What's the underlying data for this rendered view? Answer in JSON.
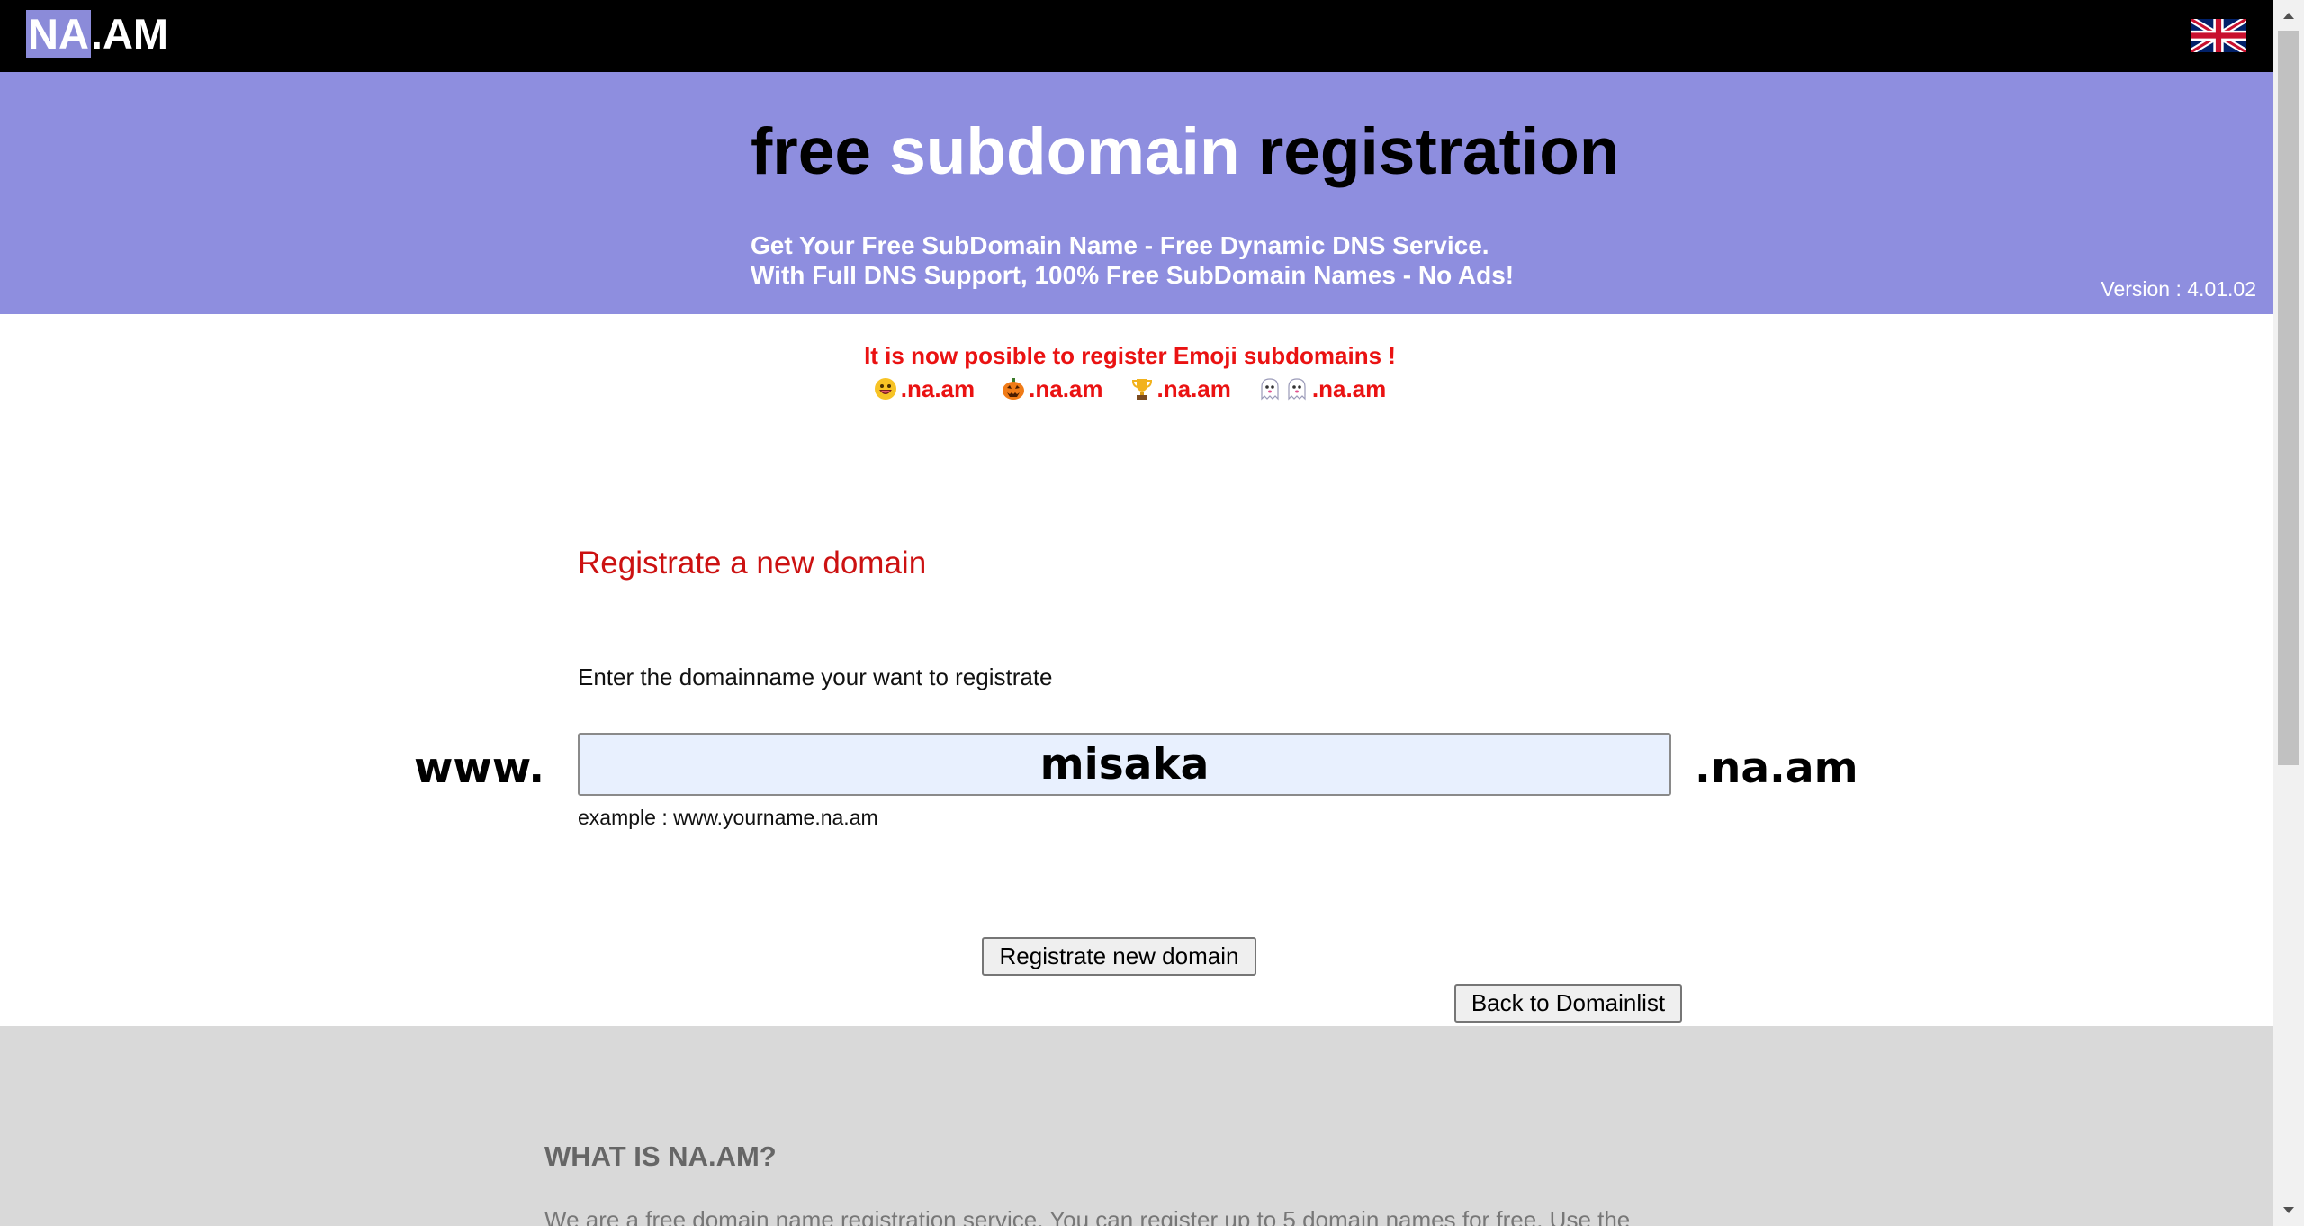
{
  "topbar": {
    "logo_highlight": "NA",
    "logo_rest": ".AM",
    "flag_icon": "uk-flag-icon"
  },
  "hero": {
    "title_part1": "free ",
    "title_part2": "subdomain",
    "title_part3": " registration",
    "subtitle_line1": "Get Your Free SubDomain Name - Free Dynamic DNS Service.",
    "subtitle_line2": "With Full DNS Support, 100% Free SubDomain Names - No Ads!",
    "version": "Version : 4.01.02"
  },
  "notice": {
    "title": "It is now posible to register Emoji subdomains !",
    "items": [
      {
        "icon": "grinning-face-icon",
        "suffix": ".na.am"
      },
      {
        "icon": "jack-o-lantern-icon",
        "suffix": ".na.am"
      },
      {
        "icon": "trophy-icon",
        "suffix": ".na.am"
      },
      {
        "icon": "ghost-icon",
        "suffix": ".na.am"
      }
    ]
  },
  "form": {
    "title": "Registrate a new domain",
    "label": "Enter the domainname your want to registrate",
    "prefix": "www.",
    "domain_value": "misaka",
    "suffix": ".na.am",
    "example": "example : www.yourname.na.am",
    "register_button": "Registrate new domain",
    "back_button": "Back to Domainlist"
  },
  "footer": {
    "title": "WHAT IS NA.AM?",
    "text": "We are a free domain name registration service. You can register up to 5 domain names for free. Use the"
  },
  "colors": {
    "topbar": "#000000",
    "hero": "#8e8edf",
    "accent_red": "#ea1212",
    "footer": "#d9d9d9"
  }
}
